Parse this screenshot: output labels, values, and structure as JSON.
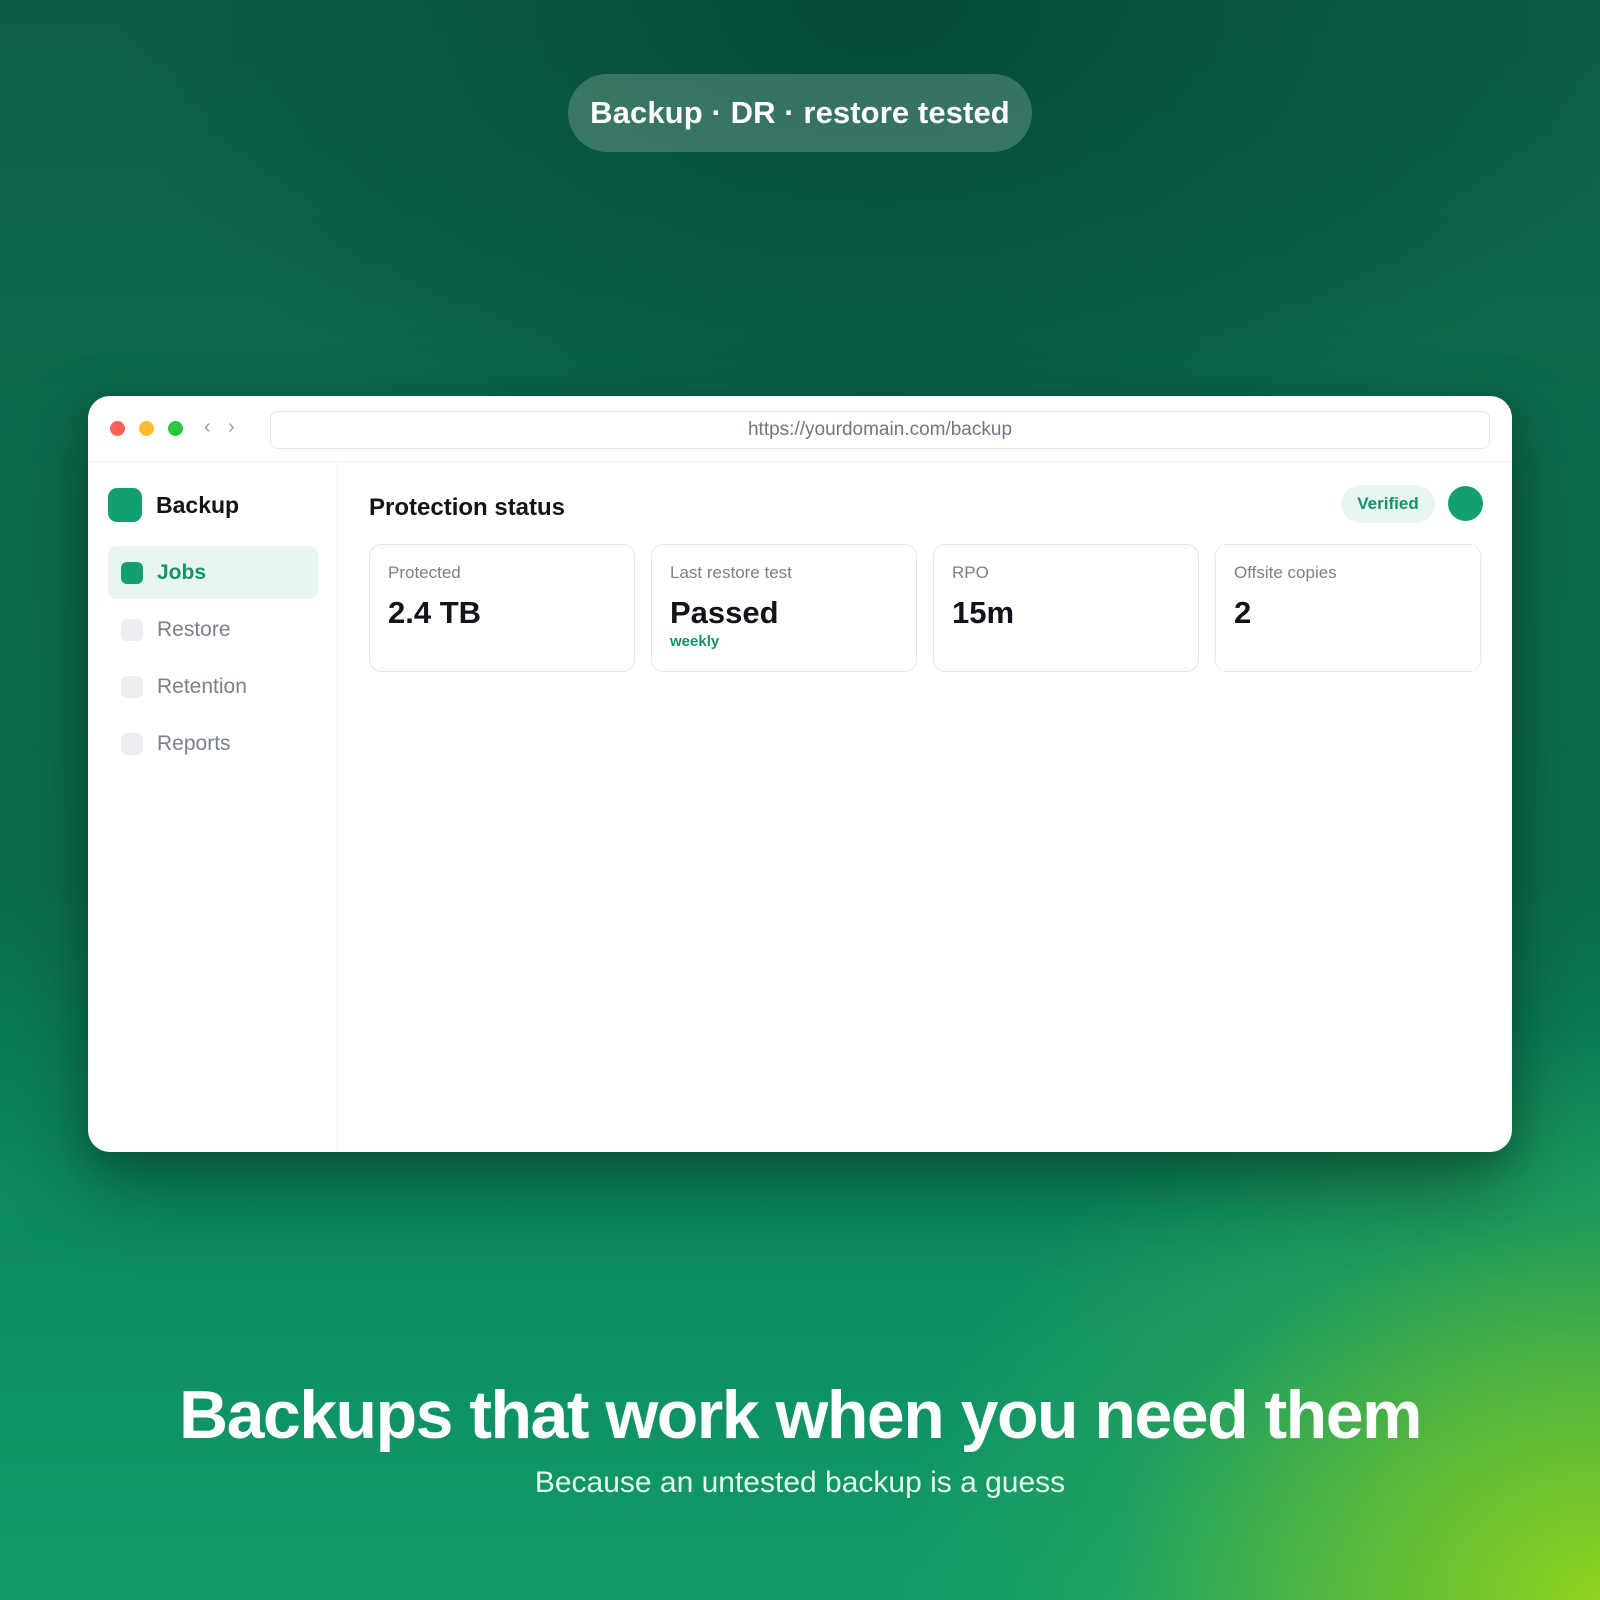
{
  "hero": {
    "pill_label": "Backup · DR · restore tested",
    "headline": "Backups that work when you need them",
    "subheadline": "Because an untested backup is a guess"
  },
  "browser": {
    "url": "https://yourdomain.com/backup",
    "back_icon": "‹",
    "forward_icon": "›"
  },
  "sidebar": {
    "brand": "Backup",
    "items": [
      {
        "label": "Jobs",
        "active": true
      },
      {
        "label": "Restore",
        "active": false
      },
      {
        "label": "Retention",
        "active": false
      },
      {
        "label": "Reports",
        "active": false
      }
    ]
  },
  "main": {
    "title": "Protection status",
    "status_badge": "Verified",
    "cards": [
      {
        "label": "Protected",
        "value": "2.4 TB",
        "sub": ""
      },
      {
        "label": "Last restore test",
        "value": "Passed",
        "sub": "weekly"
      },
      {
        "label": "RPO",
        "value": "15m",
        "sub": ""
      },
      {
        "label": "Offsite copies",
        "value": "2",
        "sub": ""
      }
    ]
  },
  "colors": {
    "accent": "#12a06e",
    "accent_text": "#109468",
    "accent_bg": "#e8f6ef"
  }
}
